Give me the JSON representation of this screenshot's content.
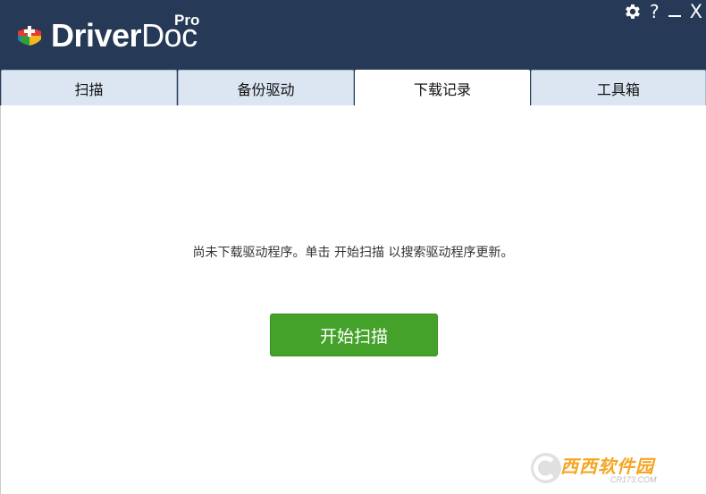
{
  "app": {
    "brand_driver": "Driver",
    "brand_doc": "Doc",
    "edition": "Pro",
    "colors": {
      "header_bg": "#263a57",
      "tab_bg": "#dce6f2",
      "tab_active_bg": "#ffffff",
      "primary_button": "#44a12a"
    }
  },
  "window_controls": {
    "settings_icon": "gear-icon",
    "help": "?",
    "close": "X"
  },
  "tabs": [
    {
      "label": "扫描",
      "active": false
    },
    {
      "label": "备份驱动",
      "active": false
    },
    {
      "label": "下载记录",
      "active": true
    },
    {
      "label": "工具箱",
      "active": false
    }
  ],
  "main": {
    "message": "尚未下载驱动程序。单击 开始扫描 以搜索驱动程序更新。",
    "scan_button": "开始扫描"
  },
  "watermark": {
    "text": "西西软件园",
    "sub": "CR173.COM"
  }
}
